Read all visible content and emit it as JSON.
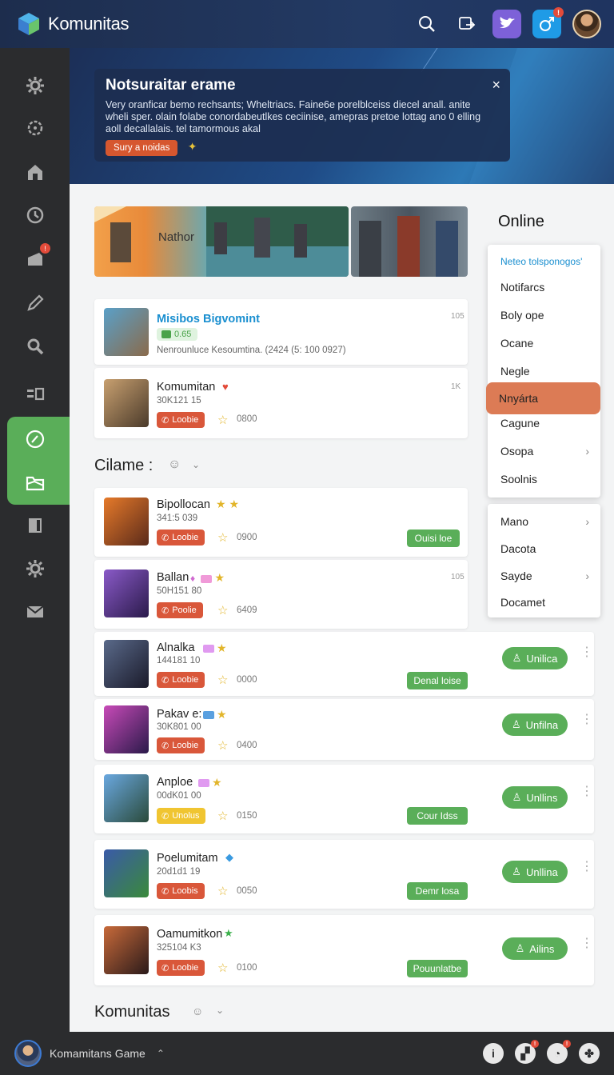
{
  "header": {
    "app_title": "Komunitas"
  },
  "banner": {
    "title": "Notsuraitar erame",
    "body": "Very oranficar bemo rechsants; Wheltriacs. Faine6e porelblceiss diecel anall. anite wheli sper. olain folabe conordabeutlkes ceciinise, amepras pretoe lottag ano 0 elling aoll decallalais. tel tamormous akal",
    "button_label": "Sury a noidas",
    "close": "×"
  },
  "hero": {
    "label": "Nathor"
  },
  "featured": [
    {
      "title": "Misibos Bigvomint",
      "pill": "0.65",
      "sub": "Nenrounluce Kesoumtina. (2424 (5: 100 0927)",
      "num": "105"
    },
    {
      "title": "Komumitan",
      "sub": "30K121 15",
      "pill": "Loobie",
      "count": "0800",
      "num": "1K"
    }
  ],
  "section1": {
    "title": "Cilame :"
  },
  "games": [
    {
      "title": "Bipollocan",
      "sub": "341:5 039",
      "pill": "Loobie",
      "count": "0900",
      "btn": "Ouisi loe",
      "num": ""
    },
    {
      "title": "Ballan",
      "sub": "50H151 80",
      "pill": "Poolie",
      "count": "6409",
      "btn": "",
      "num": "105"
    },
    {
      "title": "Alnalka",
      "sub": "144181 10",
      "pill": "Loobie",
      "count": "0000",
      "btn": "Denal loise",
      "online": "Unilica"
    },
    {
      "title": "Pakav e:",
      "sub": "30K801 00",
      "pill": "Loobie",
      "count": "0400",
      "btn": "",
      "online": "Unfilna"
    },
    {
      "title": "Anploe",
      "sub": "00dK01 00",
      "pill": "Unolus",
      "count": "0150",
      "btn": "Cour Idss",
      "online": "Unllins"
    },
    {
      "title": "Poelumitam",
      "sub": "20d1d1 19",
      "pill": "Loobis",
      "count": "0050",
      "btn": "Demr losa",
      "online": "Unllina"
    },
    {
      "title": "Oamumitkon",
      "sub": "325104 K3",
      "pill": "Loobie",
      "count": "0100",
      "btn": "Pouunlatbe",
      "online": "Ailins"
    }
  ],
  "section2": {
    "title": "Komunitas"
  },
  "online_panel": {
    "title": "Online",
    "menu1": [
      "Neteo tolsponogos'",
      "Notifarcs",
      "Boly ope",
      "Ocane",
      "Negle",
      "Nnyárta",
      "Cagune",
      "Osopa",
      "Soolnis"
    ],
    "menu2": [
      "Mano",
      "Dacota",
      "Sayde",
      "Docamet"
    ]
  },
  "footer": {
    "user_label": "Komamitans Game"
  },
  "colors": {
    "accent_green": "#5aae59",
    "accent_red": "#d9573a",
    "sidebar": "#2b2c2e",
    "header": "#1d2d4d"
  }
}
